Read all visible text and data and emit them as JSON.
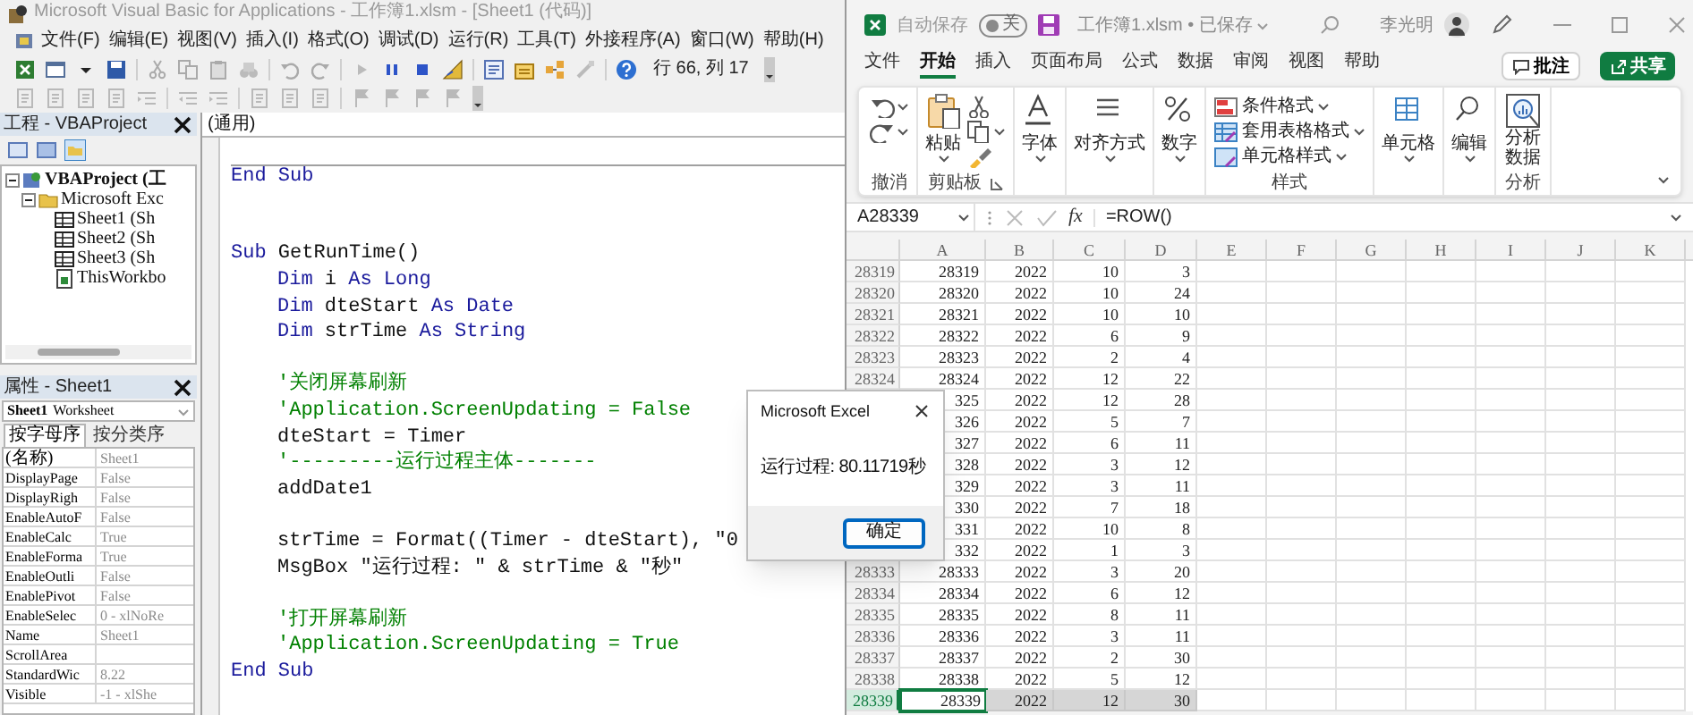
{
  "vba": {
    "title": "Microsoft Visual Basic for Applications - 工作簿1.xlsm - [Sheet1 (代码)]",
    "menu": [
      "文件(F)",
      "编辑(E)",
      "视图(V)",
      "插入(I)",
      "格式(O)",
      "调试(D)",
      "运行(R)",
      "工具(T)",
      "外接程序(A)",
      "窗口(W)",
      "帮助(H)"
    ],
    "cursor_position": "行 66, 列 17",
    "project": {
      "title": "工程 - VBAProject",
      "tree": [
        {
          "kind": "project",
          "label": "VBAProject (工",
          "expanded": true,
          "children": [
            {
              "kind": "folder",
              "label": "Microsoft Exc",
              "expanded": true,
              "children": [
                {
                  "kind": "sheet",
                  "label": "Sheet1 (Sh"
                },
                {
                  "kind": "sheet",
                  "label": "Sheet2 (Sh"
                },
                {
                  "kind": "sheet",
                  "label": "Sheet3 (Sh"
                },
                {
                  "kind": "workbook",
                  "label": "ThisWorkbo"
                }
              ]
            }
          ]
        }
      ]
    },
    "properties": {
      "title": "属性 - Sheet1",
      "object_name": "Sheet1",
      "object_type": "Worksheet",
      "tabs": [
        {
          "label": "按字母序",
          "selected": true
        },
        {
          "label": "按分类序",
          "selected": false
        }
      ],
      "rows": [
        {
          "name": "(名称)",
          "value": "Sheet1"
        },
        {
          "name": "DisplayPage",
          "value": "False"
        },
        {
          "name": "DisplayRigh",
          "value": "False"
        },
        {
          "name": "EnableAutoF",
          "value": "False"
        },
        {
          "name": "EnableCalc",
          "value": "True"
        },
        {
          "name": "EnableForma",
          "value": "True"
        },
        {
          "name": "EnableOutli",
          "value": "False"
        },
        {
          "name": "EnablePivot",
          "value": "False"
        },
        {
          "name": "EnableSelec",
          "value": "0 - xlNoRe"
        },
        {
          "name": "Name",
          "value": "Sheet1"
        },
        {
          "name": "ScrollArea"
        },
        {
          "name": "StandardWic",
          "value": "8.22"
        },
        {
          "name": "Visible",
          "value": "-1 - xlShe"
        }
      ]
    },
    "code": {
      "object": "(通用)",
      "lines": [
        {
          "kind": "blank"
        },
        {
          "kind": "code",
          "indented": false,
          "procedure_end": true,
          "segments": [
            {
              "kind": "keyword",
              "text": "End Sub"
            }
          ]
        },
        {
          "kind": "blank"
        },
        {
          "kind": "blank"
        },
        {
          "kind": "code",
          "indented": false,
          "segments": [
            {
              "kind": "keyword",
              "text": "Sub"
            },
            {
              "kind": "plain",
              "text": " GetRunTime()"
            }
          ]
        },
        {
          "kind": "code",
          "indented": true,
          "segments": [
            {
              "kind": "keyword",
              "text": "Dim"
            },
            {
              "kind": "plain",
              "text": " i "
            },
            {
              "kind": "keyword",
              "text": "As Long"
            }
          ]
        },
        {
          "kind": "code",
          "indented": true,
          "segments": [
            {
              "kind": "keyword",
              "text": "Dim"
            },
            {
              "kind": "plain",
              "text": " dteStart "
            },
            {
              "kind": "keyword",
              "text": "As Date"
            }
          ]
        },
        {
          "kind": "code",
          "indented": true,
          "segments": [
            {
              "kind": "keyword",
              "text": "Dim"
            },
            {
              "kind": "plain",
              "text": " strTime "
            },
            {
              "kind": "keyword",
              "text": "As String"
            }
          ]
        },
        {
          "kind": "blank"
        },
        {
          "kind": "code",
          "indented": true,
          "segments": [
            {
              "kind": "comment",
              "text": "'关闭屏幕刷新"
            }
          ]
        },
        {
          "kind": "code",
          "indented": true,
          "segments": [
            {
              "kind": "comment",
              "text": "'Application.ScreenUpdating = False"
            }
          ]
        },
        {
          "kind": "code",
          "indented": true,
          "segments": [
            {
              "kind": "plain",
              "text": "dteStart = Timer"
            }
          ]
        },
        {
          "kind": "code",
          "indented": true,
          "segments": [
            {
              "kind": "comment",
              "text": "'---------运行过程主体-------"
            }
          ]
        },
        {
          "kind": "code",
          "indented": true,
          "segments": [
            {
              "kind": "plain",
              "text": "addDate1"
            }
          ]
        },
        {
          "kind": "blank"
        },
        {
          "kind": "code",
          "indented": true,
          "segments": [
            {
              "kind": "plain",
              "text": "strTime = Format((Timer - dteStart), \"0"
            }
          ]
        },
        {
          "kind": "code",
          "indented": true,
          "segments": [
            {
              "kind": "plain",
              "text": "MsgBox \"运行过程: \" & strTime & \"秒\""
            }
          ]
        },
        {
          "kind": "blank"
        },
        {
          "kind": "code",
          "indented": true,
          "segments": [
            {
              "kind": "comment",
              "text": "'打开屏幕刷新"
            }
          ]
        },
        {
          "kind": "code",
          "indented": true,
          "segments": [
            {
              "kind": "comment",
              "text": "'Application.ScreenUpdating = True"
            }
          ]
        },
        {
          "kind": "code",
          "indented": false,
          "procedure_end": false,
          "segments": [
            {
              "kind": "keyword",
              "text": "End Sub"
            }
          ]
        }
      ]
    }
  },
  "dialog": {
    "title": "Microsoft Excel",
    "message": "运行过程: 80.11719秒",
    "button": "确定"
  },
  "excel": {
    "autosave_label": "自动保存",
    "autosave": {
      "on": false,
      "label": "关"
    },
    "file": "工作簿1.xlsm • 已保存",
    "user": "李光明",
    "tabs": [
      {
        "label": "文件",
        "selected": false
      },
      {
        "label": "开始",
        "selected": true
      },
      {
        "label": "插入",
        "selected": false
      },
      {
        "label": "页面布局",
        "selected": false
      },
      {
        "label": "公式",
        "selected": false
      },
      {
        "label": "数据",
        "selected": false
      },
      {
        "label": "审阅",
        "selected": false
      },
      {
        "label": "视图",
        "selected": false
      },
      {
        "label": "帮助",
        "selected": false
      }
    ],
    "comment_button": "批注",
    "share_button": "共享",
    "ribbon": [
      {
        "label": "撤消",
        "buttons": [
          {
            "kind": "small",
            "dropdown": true
          },
          {
            "kind": "small",
            "dropdown": true
          }
        ]
      },
      {
        "label": "剪贴板",
        "launcher": true,
        "buttons": [
          {
            "kind": "large",
            "label": "粘贴",
            "dropdown": true
          },
          {
            "kind": "small",
            "dropdown": false
          },
          {
            "kind": "small",
            "dropdown": true
          },
          {
            "kind": "small",
            "dropdown": false
          }
        ]
      },
      {
        "buttons": [
          {
            "kind": "large",
            "label": "字体",
            "dropdown": true
          }
        ]
      },
      {
        "buttons": [
          {
            "kind": "large",
            "label": "对齐方式",
            "dropdown": true
          }
        ]
      },
      {
        "buttons": [
          {
            "kind": "large",
            "label": "数字",
            "dropdown": true
          }
        ]
      },
      {
        "label": "样式",
        "buttons": [
          {
            "kind": "row",
            "label": "条件格式",
            "dropdown": true
          },
          {
            "kind": "row",
            "label": "套用表格格式",
            "dropdown": true
          },
          {
            "kind": "row",
            "label": "单元格样式",
            "dropdown": true
          }
        ]
      },
      {
        "buttons": [
          {
            "kind": "large",
            "label": "单元格",
            "dropdown": true
          }
        ]
      },
      {
        "buttons": [
          {
            "kind": "large",
            "label": "编辑",
            "dropdown": true
          }
        ]
      },
      {
        "label": "分析",
        "buttons": [
          {
            "kind": "large",
            "label": "分析数据",
            "dropdown": false
          }
        ]
      }
    ],
    "name_box": "A28339",
    "function_label": "fx",
    "formula": "=ROW()",
    "columns": [
      "A",
      "B",
      "C",
      "D",
      "E",
      "F",
      "G",
      "H",
      "I",
      "J",
      "K"
    ],
    "rows": [
      {
        "header": "28319",
        "cells": [
          "28319",
          "2022",
          "10",
          "3"
        ],
        "selected": false
      },
      {
        "header": "28320",
        "cells": [
          "28320",
          "2022",
          "10",
          "24"
        ],
        "selected": false
      },
      {
        "header": "28321",
        "cells": [
          "28321",
          "2022",
          "10",
          "10"
        ],
        "selected": false
      },
      {
        "header": "28322",
        "cells": [
          "28322",
          "2022",
          "6",
          "9"
        ],
        "selected": false
      },
      {
        "header": "28323",
        "cells": [
          "28323",
          "2022",
          "2",
          "4"
        ],
        "selected": false
      },
      {
        "header": "28324",
        "cells": [
          "28324",
          "2022",
          "12",
          "22"
        ],
        "selected": false
      },
      {
        "cells": [
          "325",
          "2022",
          "12",
          "28"
        ],
        "selected": false
      },
      {
        "cells": [
          "326",
          "2022",
          "5",
          "7"
        ],
        "selected": false
      },
      {
        "cells": [
          "327",
          "2022",
          "6",
          "11"
        ],
        "selected": false
      },
      {
        "cells": [
          "328",
          "2022",
          "3",
          "12"
        ],
        "selected": false
      },
      {
        "cells": [
          "329",
          "2022",
          "3",
          "11"
        ],
        "selected": false
      },
      {
        "cells": [
          "330",
          "2022",
          "7",
          "18"
        ],
        "selected": false
      },
      {
        "cells": [
          "331",
          "2022",
          "10",
          "8"
        ],
        "selected": false
      },
      {
        "cells": [
          "332",
          "2022",
          "1",
          "3"
        ],
        "selected": false
      },
      {
        "header": "28333",
        "cells": [
          "28333",
          "2022",
          "3",
          "20"
        ],
        "selected": false
      },
      {
        "header": "28334",
        "cells": [
          "28334",
          "2022",
          "6",
          "12"
        ],
        "selected": false
      },
      {
        "header": "28335",
        "cells": [
          "28335",
          "2022",
          "8",
          "11"
        ],
        "selected": false
      },
      {
        "header": "28336",
        "cells": [
          "28336",
          "2022",
          "3",
          "11"
        ],
        "selected": false
      },
      {
        "header": "28337",
        "cells": [
          "28337",
          "2022",
          "2",
          "30"
        ],
        "selected": false
      },
      {
        "header": "28338",
        "cells": [
          "28338",
          "2022",
          "5",
          "12"
        ],
        "selected": false
      },
      {
        "header": "28339",
        "cells": [
          "28339",
          "2022",
          "12",
          "30"
        ],
        "selected": true
      }
    ]
  }
}
